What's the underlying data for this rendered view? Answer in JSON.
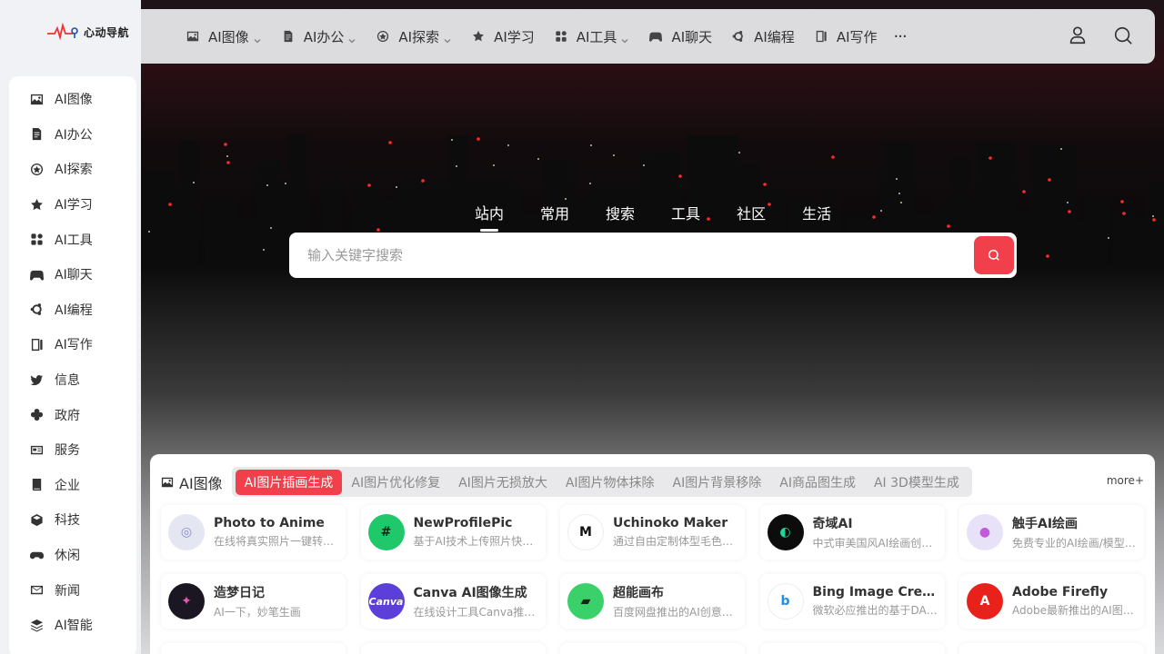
{
  "brand": {
    "name": "心动导航"
  },
  "sidebar": {
    "items": [
      {
        "label": "AI图像",
        "icon": "image-icon"
      },
      {
        "label": "AI办公",
        "icon": "document-icon"
      },
      {
        "label": "AI探索",
        "icon": "compass-icon"
      },
      {
        "label": "AI学习",
        "icon": "star-icon"
      },
      {
        "label": "AI工具",
        "icon": "apps-icon"
      },
      {
        "label": "AI聊天",
        "icon": "gamepad-icon"
      },
      {
        "label": "AI编程",
        "icon": "ubuntu-icon"
      },
      {
        "label": "AI写作",
        "icon": "notebook-icon"
      },
      {
        "label": "信息",
        "icon": "twitter-icon"
      },
      {
        "label": "政府",
        "icon": "flower-icon"
      },
      {
        "label": "服务",
        "icon": "id-card-icon"
      },
      {
        "label": "企业",
        "icon": "book-icon"
      },
      {
        "label": "科技",
        "icon": "cube-icon"
      },
      {
        "label": "休闲",
        "icon": "controller-icon"
      },
      {
        "label": "新闻",
        "icon": "mail-icon"
      },
      {
        "label": "AI智能",
        "icon": "layers-icon"
      }
    ]
  },
  "topnav": {
    "items": [
      {
        "label": "AI图像",
        "icon": "image-icon",
        "dropdown": true
      },
      {
        "label": "AI办公",
        "icon": "document-icon",
        "dropdown": true
      },
      {
        "label": "AI探索",
        "icon": "compass-icon",
        "dropdown": true
      },
      {
        "label": "AI学习",
        "icon": "star-icon",
        "dropdown": false
      },
      {
        "label": "AI工具",
        "icon": "apps-icon",
        "dropdown": true
      },
      {
        "label": "AI聊天",
        "icon": "gamepad-icon",
        "dropdown": false
      },
      {
        "label": "AI编程",
        "icon": "ubuntu-icon",
        "dropdown": false
      },
      {
        "label": "AI写作",
        "icon": "notebook-icon",
        "dropdown": false
      }
    ],
    "more": "···"
  },
  "search": {
    "tabs": [
      "站内",
      "常用",
      "搜索",
      "工具",
      "社区",
      "生活"
    ],
    "active_tab": 0,
    "placeholder": "输入关键字搜索",
    "value": ""
  },
  "section": {
    "title": "AI图像",
    "tabs": [
      "AI图片插画生成",
      "AI图片优化修复",
      "AI图片无损放大",
      "AI图片物体抹除",
      "AI图片背景移除",
      "AI商品图生成",
      "AI 3D模型生成"
    ],
    "active_tab": 0,
    "more": "more+",
    "cards": [
      {
        "name": "Photo to Anime",
        "desc": "在线将真实照片一键转换为动漫风格",
        "color": "#e4e6f2",
        "glyph": "◎",
        "glyph_color": "#8a8fc7"
      },
      {
        "name": "NewProfilePic",
        "desc": "基于AI技术上传照片快速生成头像",
        "color": "#1ec86b",
        "glyph": "#",
        "glyph_color": "#0a2a14"
      },
      {
        "name": "Uchinoko Maker",
        "desc": "通过自由定制体型毛色等生成宠物图",
        "color": "#ffffff",
        "glyph": "M",
        "glyph_color": "#111111"
      },
      {
        "name": "奇域AI",
        "desc": "中式审美国风AI绘画创作平台",
        "color": "#0c0c0c",
        "glyph": "◐",
        "glyph_color": "#22d39a"
      },
      {
        "name": "触手AI绘画",
        "desc": "免费专业的AI绘画/模型训练平台",
        "color": "#e8e2f8",
        "glyph": "●",
        "glyph_color": "#c05ad8"
      },
      {
        "name": "造梦日记",
        "desc": "AI一下，妙笔生画",
        "color": "#1a1622",
        "glyph": "✦",
        "glyph_color": "#e05ab0"
      },
      {
        "name": "Canva AI图像生成",
        "desc": "在线设计工具Canva推出的AI图像生成",
        "color": "#5b3fd8",
        "glyph": "Canva",
        "glyph_color": "#ffffff"
      },
      {
        "name": "超能画布",
        "desc": "百度网盘推出的AI创意图片生成工具",
        "color": "#3ad06a",
        "glyph": "▰",
        "glyph_color": "#0d2a14"
      },
      {
        "name": "Bing Image Creator",
        "desc": "微软必应推出的基于DALL·E的AI绘画",
        "color": "#ffffff",
        "glyph": "b",
        "glyph_color": "#1c8fe6"
      },
      {
        "name": "Adobe Firefly",
        "desc": "Adobe最新推出的AI图片生成工具",
        "color": "#e8211b",
        "glyph": "A",
        "glyph_color": "#ffffff"
      }
    ]
  }
}
